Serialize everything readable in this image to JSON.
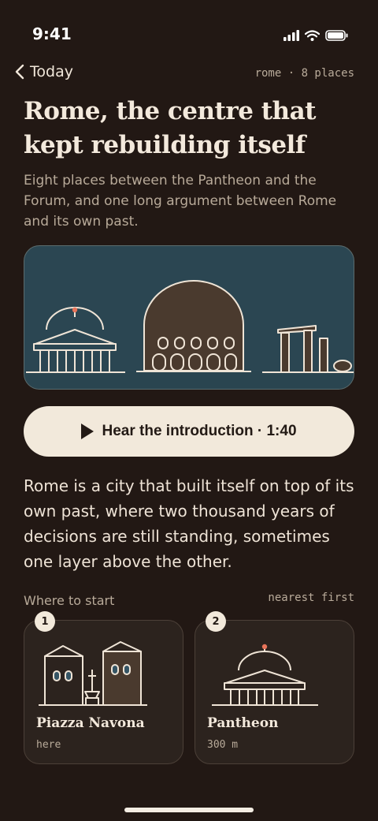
{
  "status": {
    "time": "9:41"
  },
  "nav": {
    "back_label": "Today",
    "meta": "rome · 8 places"
  },
  "title": "Rome, the centre that kept rebuilding itself",
  "lead": "Eight places between the Pantheon and the Forum, and one long argument between Rome and its own past.",
  "audio": {
    "label": "Hear the introduction · 1:40"
  },
  "intro": "Rome is a city that built itself on top of its own past, where two thousand years of decisions are still standing, sometimes one layer above the other.",
  "section": {
    "title": "Where to start",
    "sort": "nearest first"
  },
  "places": [
    {
      "number": "1",
      "name": "Piazza Navona",
      "distance": "here"
    },
    {
      "number": "2",
      "name": "Pantheon",
      "distance": "300 m"
    }
  ],
  "colors": {
    "background": "#221814",
    "accent": "#e8745a",
    "hero": "#2b4652",
    "cream": "#f2e9db"
  }
}
